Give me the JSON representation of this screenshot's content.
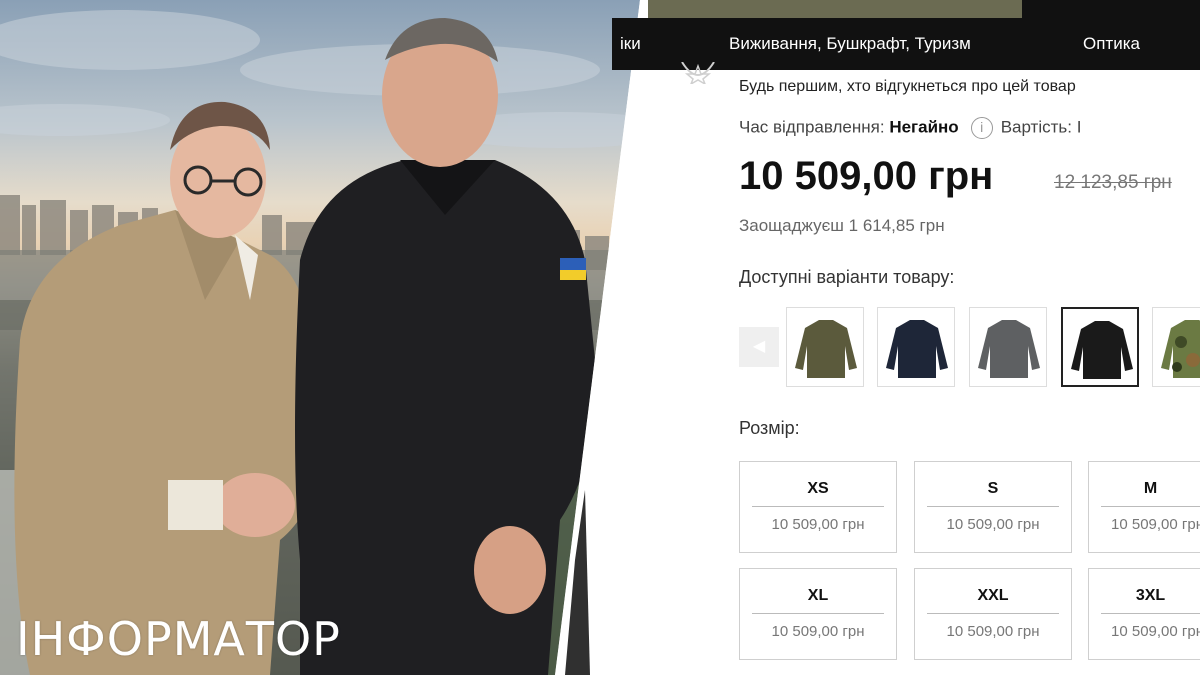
{
  "photo": {
    "watermark": "ІНФОРМАТОР"
  },
  "store": {
    "nav": {
      "items": [
        "іки",
        "Виживання, Бушкрафт, Туризм",
        "Оптика"
      ]
    },
    "review_prompt": "Будь першим, хто відгукнеться про цей товар",
    "shipping": {
      "label": "Час відправлення:",
      "value": "Негайно",
      "info_icon": "info-icon",
      "cost_label": "Вартість: І"
    },
    "price": {
      "current": "10 509,00 грн",
      "old": "12 123,85 грн",
      "savings": "Заощаджуєш 1 614,85 грн"
    },
    "variants": {
      "label": "Доступні варіанти товару:",
      "prev_icon": "chevron-left-icon",
      "swatches": [
        {
          "color": "#5b5a3c",
          "selected": false
        },
        {
          "color": "#1e2638",
          "selected": false
        },
        {
          "color": "#5e6062",
          "selected": false
        },
        {
          "color": "#1a1a1a",
          "selected": true
        },
        {
          "color": "#6b7a43",
          "selected": false
        }
      ]
    },
    "sizes": {
      "label": "Розмір:",
      "options": [
        {
          "name": "XS",
          "price": "10 509,00 грн"
        },
        {
          "name": "S",
          "price": "10 509,00 грн"
        },
        {
          "name": "M",
          "price": "10 509,00 грн"
        },
        {
          "name": "XL",
          "price": "10 509,00 грн"
        },
        {
          "name": "XXL",
          "price": "10 509,00 грн"
        },
        {
          "name": "3XL",
          "price": "10 509,00 грн"
        }
      ]
    }
  }
}
